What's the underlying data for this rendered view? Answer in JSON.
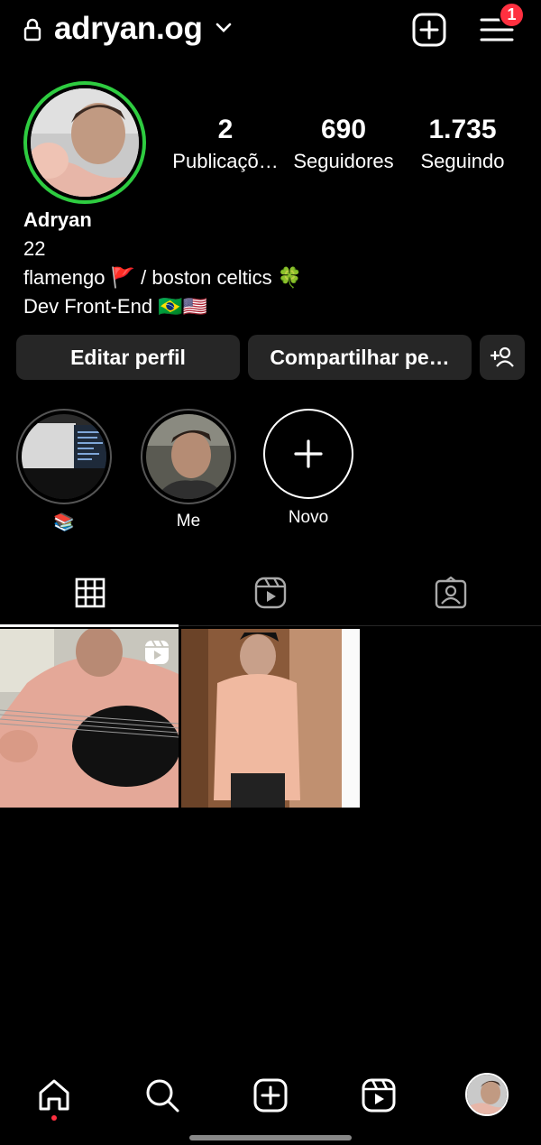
{
  "header": {
    "username": "adryan.og",
    "notification_count": "1"
  },
  "profile": {
    "stats": [
      {
        "value": "2",
        "label": "Publicaçõ…"
      },
      {
        "value": "690",
        "label": "Seguidores"
      },
      {
        "value": "1.735",
        "label": "Seguindo"
      }
    ],
    "name": "Adryan",
    "bio_lines": [
      "22",
      "flamengo 🚩 / boston celtics 🍀",
      "Dev Front-End 🇧🇷🇺🇸"
    ]
  },
  "actions": {
    "edit_label": "Editar perfil",
    "share_label": "Compartilhar pe…"
  },
  "highlights": [
    {
      "label": "📚"
    },
    {
      "label": "Me"
    },
    {
      "label": "Novo"
    }
  ],
  "tabs": [
    {
      "icon": "grid-icon",
      "active": true
    },
    {
      "icon": "reels-icon",
      "active": false
    },
    {
      "icon": "tagged-icon",
      "active": false
    }
  ],
  "posts": [
    {
      "type": "reel",
      "icon": "reel-badge-icon"
    },
    {
      "type": "photo"
    }
  ],
  "bottom_nav": [
    {
      "icon": "home-icon",
      "active": true
    },
    {
      "icon": "search-icon"
    },
    {
      "icon": "create-icon"
    },
    {
      "icon": "reels-icon"
    },
    {
      "icon": "profile-avatar"
    }
  ],
  "colors": {
    "story_ring": "#2ecc40",
    "notification": "#ff3040",
    "button_bg": "#262626"
  }
}
